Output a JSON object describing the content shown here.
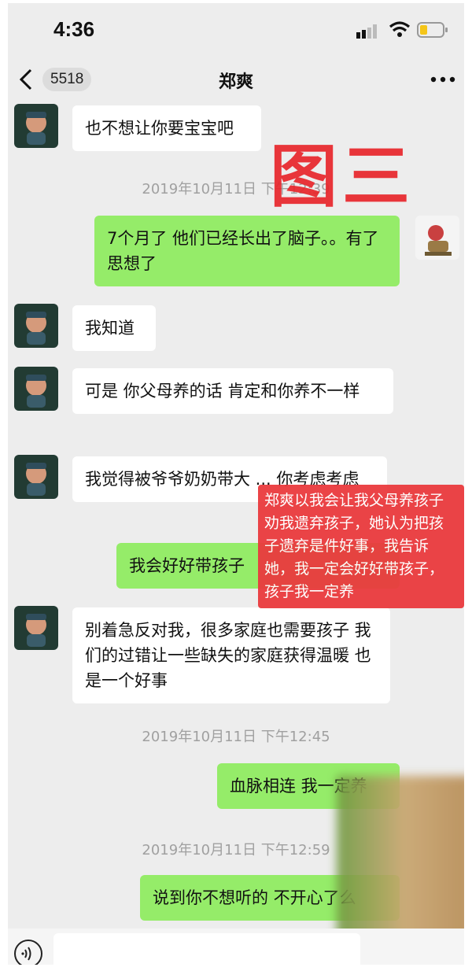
{
  "status": {
    "time": "4:36"
  },
  "nav": {
    "back_count": "5518",
    "title": "郑爽"
  },
  "stamp": "图三",
  "timestamps": [
    "2019年10月11日 下午12:39",
    "2019年10月11日 下午12:45",
    "2019年10月11日 下午12:59"
  ],
  "messages": [
    {
      "side": "left",
      "text": "也不想让你要宝宝吧"
    },
    {
      "side": "right",
      "text": "7个月了 他们已经长出了脑子。。有了思想了"
    },
    {
      "side": "left",
      "text": "我知道"
    },
    {
      "side": "left",
      "text": "可是 你父母养的话 肯定和你养不一样"
    },
    {
      "side": "left",
      "text": "我觉得被爷爷奶奶带大 ... 你考虑考虑"
    },
    {
      "side": "right",
      "text": "我会好好带孩子"
    },
    {
      "side": "left",
      "text": "别着急反对我，很多家庭也需要孩子 我们的过错让一些缺失的家庭获得温暖 也是一个好事"
    },
    {
      "side": "right",
      "text": "血脉相连 我一定养"
    },
    {
      "side": "right",
      "text": "说到你不想听的 不开心了么"
    }
  ],
  "annotation": "郑爽以我会让我父母养孩子劝我遗弃孩子，她认为把孩子遗弃是件好事，我告诉她，我一定会好好带孩子，孩子我一定养",
  "colors": {
    "left_bubble": "#ffffff",
    "right_bubble": "#95ec69",
    "stamp": "#e8262b",
    "background": "#ededed"
  }
}
